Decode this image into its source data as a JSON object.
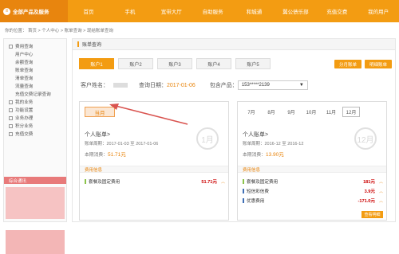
{
  "nav": {
    "brand": "全部产品及服务",
    "items": [
      "首页",
      "手机",
      "宽带大厅",
      "自助服务",
      "和城通",
      "翼公债乐部",
      "充值交费",
      "我的用户"
    ]
  },
  "breadcrumb": "你的位置： 首页 > 个人中心 > 账单查询 > 现结账单查询",
  "sidebar": {
    "items": [
      {
        "label": "费用查询",
        "sub": false
      },
      {
        "label": "用户中心",
        "sub": true
      },
      {
        "label": "余额查询",
        "sub": true
      },
      {
        "label": "账单查询",
        "sub": true
      },
      {
        "label": "清单查询",
        "sub": true
      },
      {
        "label": "流量查询",
        "sub": true
      },
      {
        "label": "充值交费记录查询",
        "sub": true
      },
      {
        "label": "我的业务",
        "sub": false
      },
      {
        "label": "功能设置",
        "sub": false
      },
      {
        "label": "业务办理",
        "sub": false
      },
      {
        "label": "积分业务",
        "sub": false
      },
      {
        "label": "充值交费",
        "sub": false
      }
    ],
    "section": "综合通讯"
  },
  "main": {
    "title": "账单查询",
    "tabs": [
      "账户1",
      "账户2",
      "账户3",
      "账户4",
      "账户5"
    ],
    "btn_analysis": "分月账单",
    "btn_detail": "明细账单",
    "info": {
      "name_label": "客户姓名：",
      "date_label": "查询日期：",
      "date": "2017-01-06",
      "product_label": "包含产品：",
      "product": "153*****2139"
    },
    "left": {
      "month_tab": "当月",
      "title": "个人账单>",
      "period": "账单周期：2017-01-03 至 2017-01-06",
      "cost_label": "本期消费：",
      "cost": "51.71元",
      "circle": "1月",
      "section": "费用信息",
      "rows": [
        {
          "label": "套餐及固定费用",
          "amount": "51.71元",
          "caret": "︿"
        }
      ]
    },
    "right": {
      "months": [
        "7月",
        "8月",
        "9月",
        "10月",
        "11月",
        "12月"
      ],
      "title": "个人账单>",
      "period": "账单周期：2016-12 至 2016-12",
      "cost_label": "本期消费：",
      "cost": "13.90元",
      "circle": "12月",
      "section": "费用信息",
      "rows": [
        {
          "label": "套餐及固定费用",
          "amount": "181元",
          "caret": "︿"
        },
        {
          "label": "短信彩信费",
          "amount": "3.9元",
          "caret": "︿"
        },
        {
          "label": "优惠费用",
          "amount": "-171.0元",
          "caret": "︿"
        }
      ],
      "action": "查看明细"
    }
  },
  "colors": {
    "accent": "#f39c12",
    "arrow": "#d9534f"
  }
}
